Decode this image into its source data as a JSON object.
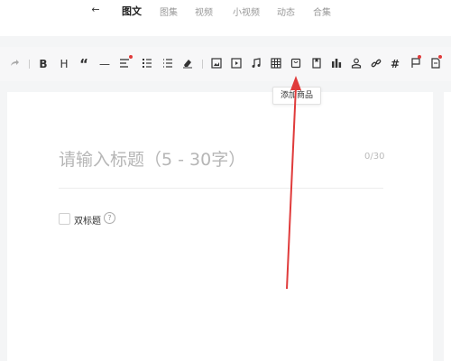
{
  "nav": {
    "back_icon": "arrow-left-icon",
    "tabs": [
      {
        "label": "图文",
        "active": true
      },
      {
        "label": "图集",
        "active": false
      },
      {
        "label": "视频",
        "active": false
      },
      {
        "label": "小视频",
        "active": false
      },
      {
        "label": "动态",
        "active": false
      },
      {
        "label": "合集",
        "active": false
      }
    ]
  },
  "toolbar": {
    "redo_icon": "redo-icon",
    "bold": "B",
    "heading": "H",
    "quote": "“",
    "divider": "—",
    "align_icon": "align-icon",
    "ordered_list_icon": "ordered-list-icon",
    "unordered_list_icon": "unordered-list-icon",
    "clear_format_icon": "eraser-icon",
    "image_icon": "image-icon",
    "video_icon": "video-icon",
    "music_icon": "music-icon",
    "table_icon": "table-icon",
    "add_product_icon": "product-icon",
    "bookmark_icon": "bookmark-icon",
    "chart_icon": "chart-icon",
    "user_icon": "user-icon",
    "link_icon": "link-icon",
    "hashtag": "#",
    "flag_icon": "flag-icon",
    "document_icon": "document-icon"
  },
  "tooltip": {
    "text": "添加商品"
  },
  "editor": {
    "title_placeholder": "请输入标题（5 - 30字）",
    "title_counter": "0/30",
    "double_title_label": "双标题",
    "help_icon": "question-icon",
    "help_glyph": "?"
  },
  "colors": {
    "annotation_arrow": "#e03b3b",
    "notification_dot": "#e03b3b"
  }
}
